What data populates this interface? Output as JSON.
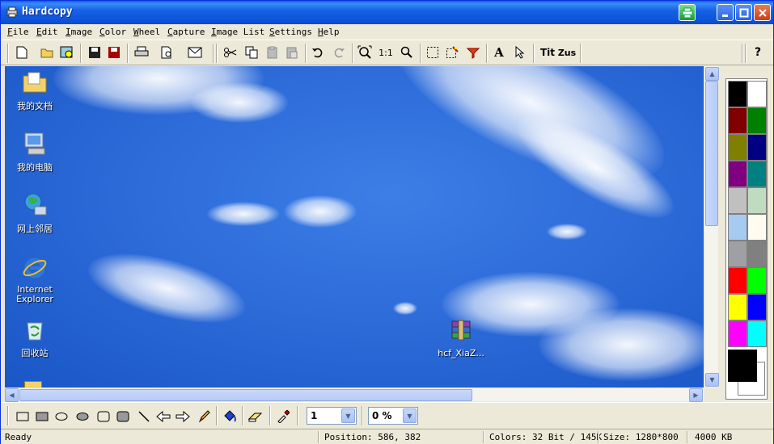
{
  "window": {
    "title": "Hardcopy"
  },
  "menu": [
    "File",
    "Edit",
    "Image",
    "Color",
    "Wheel",
    "Capture",
    "Image List",
    "Settings",
    "Help"
  ],
  "toolbar": {
    "zoom_1to1": "1:1",
    "text_label": "A",
    "title_label": "Tit",
    "zus_label": "Zus",
    "help_label": "?"
  },
  "desktop_icons": [
    {
      "label": "我的文档",
      "icon": "my-documents-icon"
    },
    {
      "label": "我的电脑",
      "icon": "my-computer-icon"
    },
    {
      "label": "网上邻居",
      "icon": "network-places-icon"
    },
    {
      "label": "Internet\nExplorer",
      "icon": "internet-explorer-icon"
    },
    {
      "label": "回收站",
      "icon": "recycle-bin-icon"
    },
    {
      "label": "hcf_XiaZ...",
      "icon": "winrar-archive-icon"
    }
  ],
  "palette": [
    "#000000",
    "#ffffff",
    "#800000",
    "#008000",
    "#808000",
    "#000080",
    "#800080",
    "#008080",
    "#c0c0c0",
    "#c0dcc0",
    "#a6caf0",
    "#fffbf0",
    "#a0a0a4",
    "#808080",
    "#ff0000",
    "#00ff00",
    "#ffff00",
    "#0000ff",
    "#ff00ff",
    "#00ffff"
  ],
  "drawbar": {
    "line_width": "1",
    "transparency": "0 %"
  },
  "status": {
    "ready": "Ready",
    "position": "Position: 586, 382",
    "colors": "Colors: 32 Bit / 145K",
    "size": "Size: 1280*800",
    "memory": "4000 KB"
  }
}
